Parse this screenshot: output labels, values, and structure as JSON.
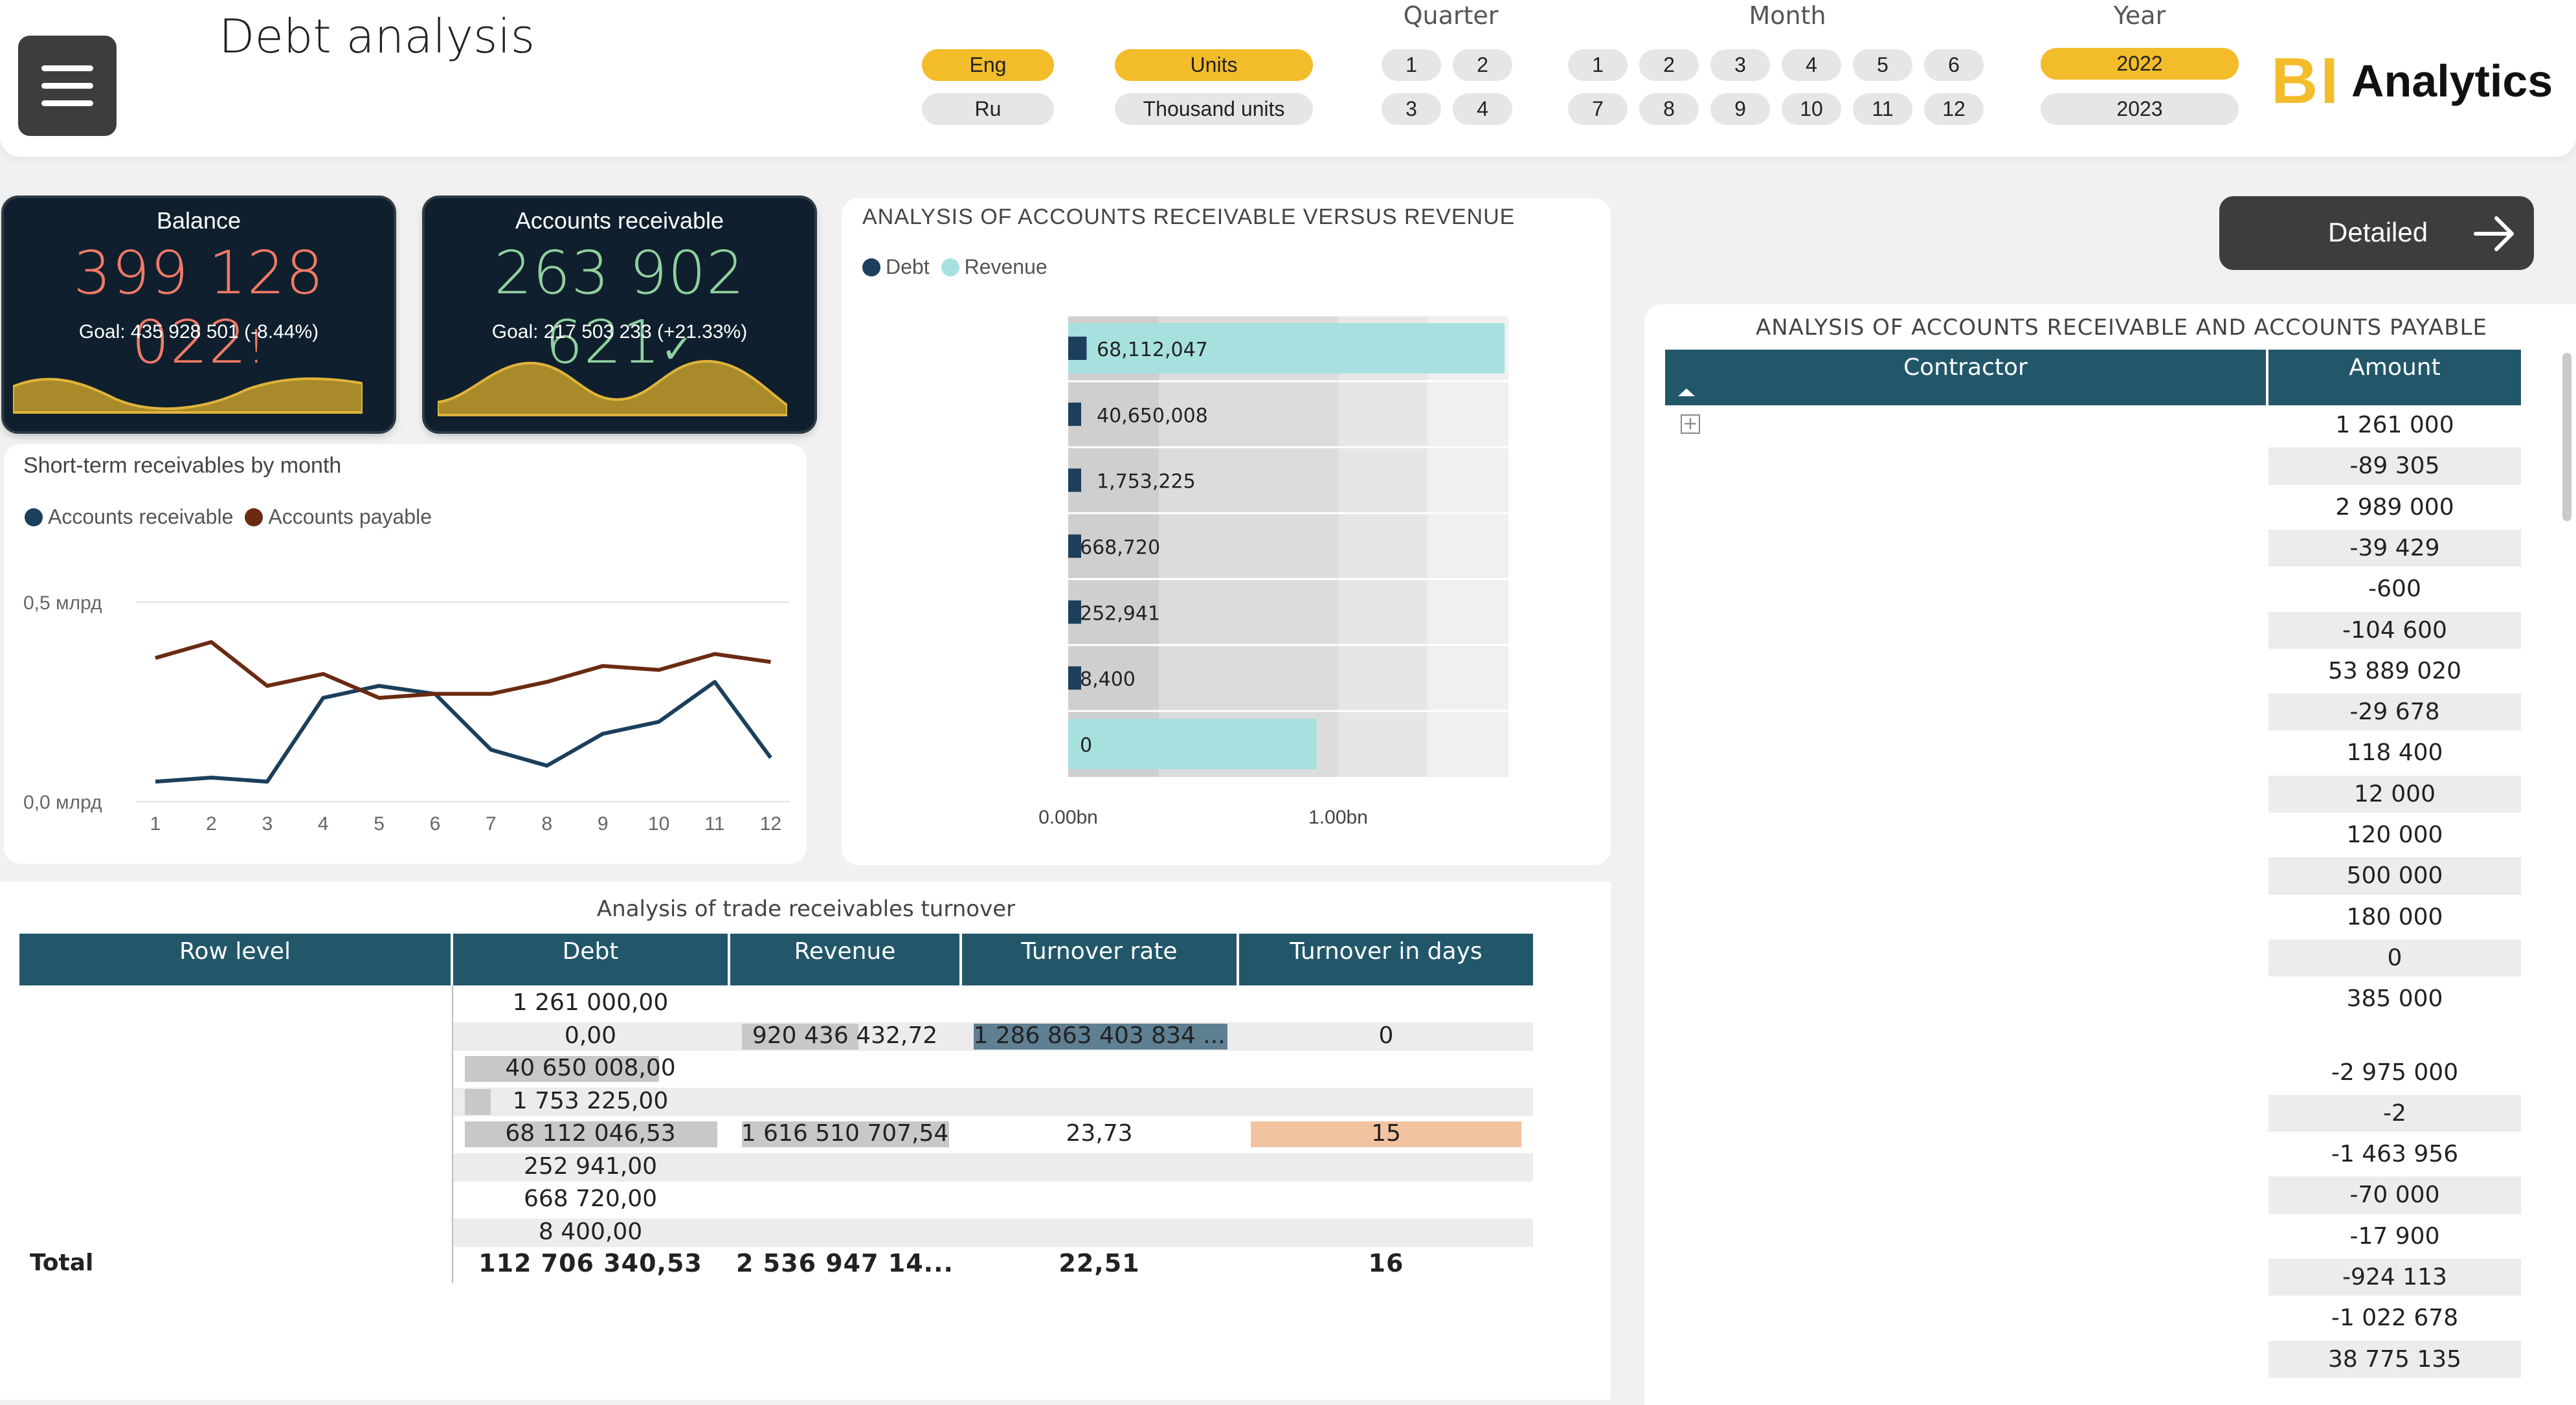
{
  "header": {
    "title": "Debt analysis",
    "language": {
      "options": [
        "Eng",
        "Ru"
      ],
      "selected": "Eng"
    },
    "units": {
      "options": [
        "Units",
        "Thousand units"
      ],
      "selected": "Units"
    },
    "quarter": {
      "title": "Quarter",
      "options": [
        "1",
        "2",
        "3",
        "4"
      ]
    },
    "month": {
      "title": "Month",
      "options": [
        "1",
        "2",
        "3",
        "4",
        "5",
        "6",
        "7",
        "8",
        "9",
        "10",
        "11",
        "12"
      ]
    },
    "year": {
      "title": "Year",
      "options": [
        "2022",
        "2023"
      ],
      "selected": "2022"
    },
    "logo": {
      "mark": "BI",
      "text": "Analytics"
    }
  },
  "kpis": {
    "balance": {
      "title": "Balance",
      "value": "399 128 022",
      "status_icon": "!",
      "goal": "Goal: 435 928 501 (-8.44%)",
      "color": "#f07a66"
    },
    "receivable": {
      "title": "Accounts receivable",
      "value": "263 902 621",
      "status_icon": "✓",
      "goal": "Goal: 217 503 233 (+21.33%)",
      "color": "#8fd19e"
    }
  },
  "detailed_button": {
    "label": "Detailed",
    "icon": "arrow-right-icon"
  },
  "colors": {
    "debt": "#1b3f5c",
    "revenue": "#a6e1df",
    "payable": "#6b2a12",
    "header": "#22576a",
    "accent": "#f3bc2b"
  },
  "chart_data": [
    {
      "type": "line",
      "title": "Short-term receivables by month",
      "x": [
        1,
        2,
        3,
        4,
        5,
        6,
        7,
        8,
        9,
        10,
        11,
        12
      ],
      "series": [
        {
          "name": "Accounts receivable",
          "values": [
            0.05,
            0.06,
            0.05,
            0.26,
            0.29,
            0.27,
            0.13,
            0.09,
            0.17,
            0.2,
            0.3,
            0.11
          ]
        },
        {
          "name": "Accounts payable",
          "values": [
            0.36,
            0.4,
            0.29,
            0.32,
            0.26,
            0.27,
            0.27,
            0.3,
            0.34,
            0.33,
            0.37,
            0.35
          ]
        }
      ],
      "ytick_labels": [
        "0,5 млрд",
        "0,0 млрд"
      ],
      "ylim": [
        0,
        0.5
      ]
    },
    {
      "type": "bar",
      "orientation": "horizontal",
      "title": "ANALYSIS OF ACCOUNTS RECEIVABLE VERSUS REVENUE",
      "categories_labels": [
        "68,112,047",
        "40,650,008",
        "1,753,225",
        "668,720",
        "252,941",
        "8,400",
        "0"
      ],
      "series": [
        {
          "name": "Debt",
          "values": [
            68112047,
            40650008,
            1753225,
            668720,
            252941,
            8400,
            0
          ]
        },
        {
          "name": "Revenue",
          "values": [
            1616510707,
            0,
            0,
            0,
            0,
            0,
            920436433
          ]
        }
      ],
      "xtick_labels": [
        "0.00bn",
        "1.00bn"
      ],
      "xlim": [
        0,
        1.65
      ]
    }
  ],
  "turnover": {
    "title": "Analysis of trade receivables turnover",
    "columns": [
      "Row level",
      "Debt",
      "Revenue",
      "Turnover rate",
      "Turnover in days"
    ],
    "rows": [
      {
        "debt": "1 261 000,00",
        "revenue": "",
        "rate": "",
        "days": ""
      },
      {
        "debt": "0,00",
        "revenue": "920 436 432,72",
        "rate": "1 286 863 403 834 ...",
        "days": "0"
      },
      {
        "debt": "40 650 008,00",
        "revenue": "",
        "rate": "",
        "days": ""
      },
      {
        "debt": "1 753 225,00",
        "revenue": "",
        "rate": "",
        "days": ""
      },
      {
        "debt": "68 112 046,53",
        "revenue": "1 616 510 707,54",
        "rate": "23,73",
        "days": "15"
      },
      {
        "debt": "252 941,00",
        "revenue": "",
        "rate": "",
        "days": ""
      },
      {
        "debt": "668 720,00",
        "revenue": "",
        "rate": "",
        "days": ""
      },
      {
        "debt": "8 400,00",
        "revenue": "",
        "rate": "",
        "days": ""
      }
    ],
    "total": {
      "label": "Total",
      "debt": "112 706 340,53",
      "revenue": "2 536 947 14...",
      "rate": "22,51",
      "days": "16"
    }
  },
  "ar_ap": {
    "title": "ANALYSIS OF ACCOUNTS RECEIVABLE AND ACCOUNTS PAYABLE",
    "columns": [
      "Contractor",
      "Amount"
    ],
    "amounts": [
      "1 261 000",
      "-89 305",
      "2 989 000",
      "-39 429",
      "-600",
      "-104 600",
      "53 889 020",
      "-29 678",
      "118 400",
      "12 000",
      "120 000",
      "500 000",
      "180 000",
      "0",
      "385 000",
      "",
      "-2 975 000",
      "-2",
      "-1 463 956",
      "-70 000",
      "-17 900",
      "-924 113",
      "-1 022 678",
      "38 775 135"
    ]
  }
}
